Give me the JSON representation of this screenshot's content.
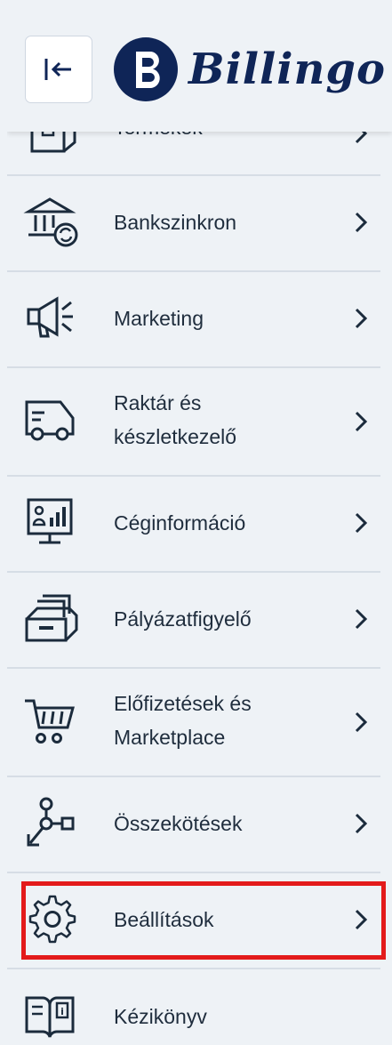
{
  "header": {
    "collapse_icon": "collapse-left-icon",
    "brand_name": "Billingo",
    "brand_color": "#0f2557"
  },
  "menu": {
    "items": [
      {
        "label": "Termékek",
        "icon": "box-icon"
      },
      {
        "label": "Bankszinkron",
        "icon": "bank-sync-icon"
      },
      {
        "label": "Marketing",
        "icon": "megaphone-icon"
      },
      {
        "label": "Raktár és\nkészletkezelő",
        "icon": "truck-icon"
      },
      {
        "label": "Céginformáció",
        "icon": "monitor-chart-icon"
      },
      {
        "label": "Pályázatfigyelő",
        "icon": "file-drawer-icon"
      },
      {
        "label": "Előfizetések és\nMarketplace",
        "icon": "cart-icon"
      },
      {
        "label": "Összekötések",
        "icon": "connections-icon"
      },
      {
        "label": "Beállítások",
        "icon": "gear-icon"
      },
      {
        "label": "Kézikönyv",
        "icon": "book-icon"
      }
    ]
  },
  "highlight_color": "#e31b1b"
}
